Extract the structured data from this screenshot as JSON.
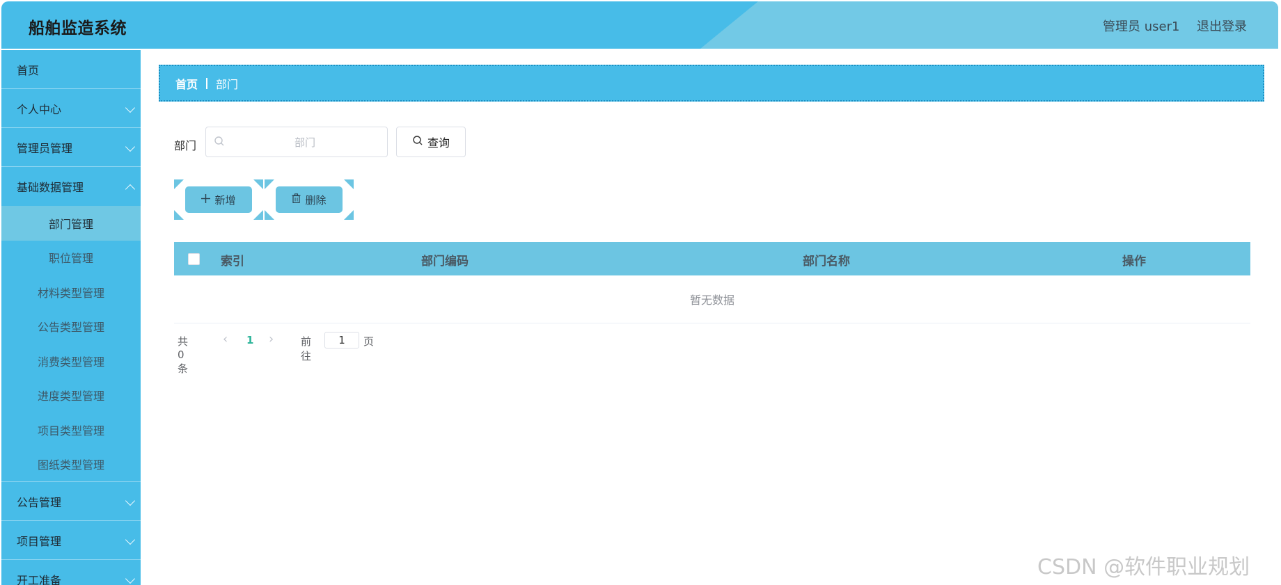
{
  "header": {
    "app_title": "船舶监造系统",
    "user_label": "管理员 user1",
    "logout_label": "退出登录"
  },
  "sidebar": {
    "home": "首页",
    "personal_center": "个人中心",
    "admin_management": "管理员管理",
    "base_data_management": "基础数据管理",
    "sub_items": [
      "部门管理",
      "职位管理",
      "材料类型管理",
      "公告类型管理",
      "消费类型管理",
      "进度类型管理",
      "项目类型管理",
      "图纸类型管理"
    ],
    "active_sub_item": "部门管理",
    "notice_management": "公告管理",
    "project_management": "项目管理",
    "work_prep": "开工准备"
  },
  "breadcrumb": {
    "home": "首页",
    "current": "部门"
  },
  "search": {
    "label": "部门",
    "placeholder": "部门",
    "value": "",
    "query_button": "查询"
  },
  "actions": {
    "add": "新增",
    "delete": "删除"
  },
  "table": {
    "columns": [
      "索引",
      "部门编码",
      "部门名称",
      "操作"
    ],
    "empty_text": "暂无数据"
  },
  "pagination": {
    "total_text": "共 0 条",
    "current_page": "1",
    "goto_label": "前往",
    "goto_value": "1",
    "page_suffix": "页"
  },
  "watermark": "CSDN @软件职业规划",
  "colors": {
    "primary": "#47bce8",
    "secondary": "#6cc5e2",
    "active_page": "#2fb59b"
  },
  "icons": {
    "chevron_down": "chevron-down-icon",
    "chevron_up": "chevron-up-icon",
    "search": "search-icon",
    "add": "plus-icon",
    "delete": "trash-icon",
    "prev": "chevron-left-icon",
    "next": "chevron-right-icon"
  }
}
